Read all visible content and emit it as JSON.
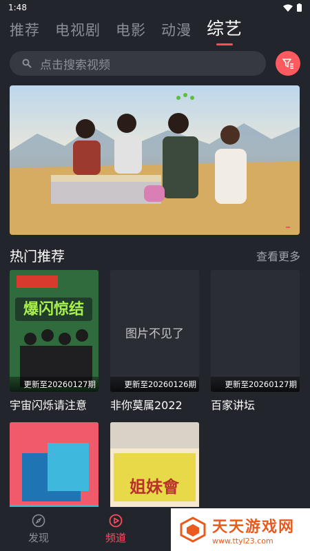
{
  "status_bar": {
    "time": "1:48"
  },
  "tabs": [
    {
      "label": "推荐"
    },
    {
      "label": "电视剧"
    },
    {
      "label": "电影"
    },
    {
      "label": "动漫"
    },
    {
      "label": "综艺",
      "active": true
    }
  ],
  "search": {
    "placeholder": "点击搜索视频"
  },
  "banner": {
    "active_index": 0
  },
  "section": {
    "title": "热门推荐",
    "more": "查看更多"
  },
  "cards": [
    {
      "title": "宇宙闪烁请注意",
      "update": "更新至20260127期",
      "poster_text": "爆闪惊结"
    },
    {
      "title": "非你莫属2022",
      "update": "更新至20260126期",
      "missing_text": "图片不见了"
    },
    {
      "title": "百家讲坛",
      "update": "更新至20260127期"
    },
    {
      "title": "",
      "update": ""
    },
    {
      "title": "",
      "update": "",
      "poster_text": "姐妹會"
    }
  ],
  "bottom_nav": [
    {
      "label": "发现",
      "icon": "compass-icon"
    },
    {
      "label": "频道",
      "icon": "play-icon",
      "active": true
    }
  ],
  "watermark": {
    "title": "天天游戏网",
    "url": "www.ttyl23.com"
  },
  "colors": {
    "accent": "#ff4d5b",
    "background": "#23252c",
    "search_bg": "#373941"
  }
}
